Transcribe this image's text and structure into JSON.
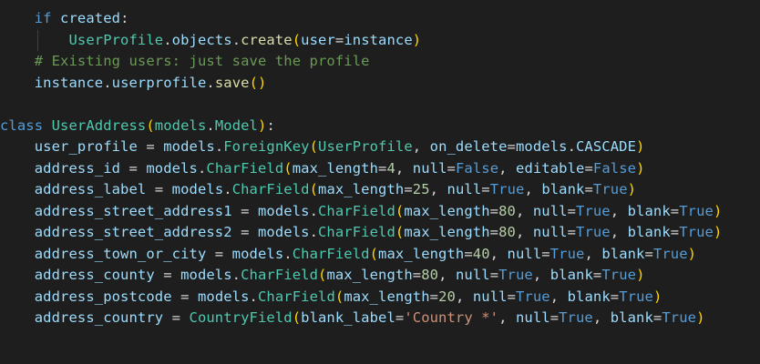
{
  "code_lines": [
    [
      {
        "t": "    ",
        "c": "pl"
      },
      {
        "t": "if",
        "c": "kw"
      },
      {
        "t": " ",
        "c": "pl"
      },
      {
        "t": "created",
        "c": "var"
      },
      {
        "t": ":",
        "c": "pl"
      }
    ],
    [
      {
        "t": "        ",
        "c": "pl"
      },
      {
        "t": "UserProfile",
        "c": "cls"
      },
      {
        "t": ".",
        "c": "pl"
      },
      {
        "t": "objects",
        "c": "var"
      },
      {
        "t": ".",
        "c": "pl"
      },
      {
        "t": "create",
        "c": "fn"
      },
      {
        "t": "(",
        "c": "p1"
      },
      {
        "t": "user",
        "c": "var"
      },
      {
        "t": "=",
        "c": "pl"
      },
      {
        "t": "instance",
        "c": "var"
      },
      {
        "t": ")",
        "c": "p1"
      }
    ],
    [
      {
        "t": "    ",
        "c": "pl"
      },
      {
        "t": "# Existing users: just save the profile",
        "c": "cm"
      }
    ],
    [
      {
        "t": "    ",
        "c": "pl"
      },
      {
        "t": "instance",
        "c": "var"
      },
      {
        "t": ".",
        "c": "pl"
      },
      {
        "t": "userprofile",
        "c": "var"
      },
      {
        "t": ".",
        "c": "pl"
      },
      {
        "t": "save",
        "c": "fn"
      },
      {
        "t": "()",
        "c": "p1"
      }
    ],
    [],
    [
      {
        "t": "class",
        "c": "kw"
      },
      {
        "t": " ",
        "c": "pl"
      },
      {
        "t": "UserAddress",
        "c": "cls"
      },
      {
        "t": "(",
        "c": "p1"
      },
      {
        "t": "models",
        "c": "cls"
      },
      {
        "t": ".",
        "c": "pl"
      },
      {
        "t": "Model",
        "c": "cls"
      },
      {
        "t": ")",
        "c": "p1"
      },
      {
        "t": ":",
        "c": "pl"
      }
    ],
    [
      {
        "t": "    ",
        "c": "pl"
      },
      {
        "t": "user_profile",
        "c": "var"
      },
      {
        "t": " = ",
        "c": "pl"
      },
      {
        "t": "models",
        "c": "var"
      },
      {
        "t": ".",
        "c": "pl"
      },
      {
        "t": "ForeignKey",
        "c": "cls"
      },
      {
        "t": "(",
        "c": "p1"
      },
      {
        "t": "UserProfile",
        "c": "cls"
      },
      {
        "t": ", ",
        "c": "pl"
      },
      {
        "t": "on_delete",
        "c": "var"
      },
      {
        "t": "=",
        "c": "pl"
      },
      {
        "t": "models",
        "c": "var"
      },
      {
        "t": ".",
        "c": "pl"
      },
      {
        "t": "CASCADE",
        "c": "var"
      },
      {
        "t": ")",
        "c": "p1"
      }
    ],
    [
      {
        "t": "    ",
        "c": "pl"
      },
      {
        "t": "address_id",
        "c": "var"
      },
      {
        "t": " = ",
        "c": "pl"
      },
      {
        "t": "models",
        "c": "var"
      },
      {
        "t": ".",
        "c": "pl"
      },
      {
        "t": "CharField",
        "c": "cls"
      },
      {
        "t": "(",
        "c": "p1"
      },
      {
        "t": "max_length",
        "c": "var"
      },
      {
        "t": "=",
        "c": "pl"
      },
      {
        "t": "4",
        "c": "num"
      },
      {
        "t": ", ",
        "c": "pl"
      },
      {
        "t": "null",
        "c": "var"
      },
      {
        "t": "=",
        "c": "pl"
      },
      {
        "t": "False",
        "c": "bool"
      },
      {
        "t": ", ",
        "c": "pl"
      },
      {
        "t": "editable",
        "c": "var"
      },
      {
        "t": "=",
        "c": "pl"
      },
      {
        "t": "False",
        "c": "bool"
      },
      {
        "t": ")",
        "c": "p1"
      }
    ],
    [
      {
        "t": "    ",
        "c": "pl"
      },
      {
        "t": "address_label",
        "c": "var"
      },
      {
        "t": " = ",
        "c": "pl"
      },
      {
        "t": "models",
        "c": "var"
      },
      {
        "t": ".",
        "c": "pl"
      },
      {
        "t": "CharField",
        "c": "cls"
      },
      {
        "t": "(",
        "c": "p1"
      },
      {
        "t": "max_length",
        "c": "var"
      },
      {
        "t": "=",
        "c": "pl"
      },
      {
        "t": "25",
        "c": "num"
      },
      {
        "t": ", ",
        "c": "pl"
      },
      {
        "t": "null",
        "c": "var"
      },
      {
        "t": "=",
        "c": "pl"
      },
      {
        "t": "True",
        "c": "bool"
      },
      {
        "t": ", ",
        "c": "pl"
      },
      {
        "t": "blank",
        "c": "var"
      },
      {
        "t": "=",
        "c": "pl"
      },
      {
        "t": "True",
        "c": "bool"
      },
      {
        "t": ")",
        "c": "p1"
      }
    ],
    [
      {
        "t": "    ",
        "c": "pl"
      },
      {
        "t": "address_street_address1",
        "c": "var"
      },
      {
        "t": " = ",
        "c": "pl"
      },
      {
        "t": "models",
        "c": "var"
      },
      {
        "t": ".",
        "c": "pl"
      },
      {
        "t": "CharField",
        "c": "cls"
      },
      {
        "t": "(",
        "c": "p1"
      },
      {
        "t": "max_length",
        "c": "var"
      },
      {
        "t": "=",
        "c": "pl"
      },
      {
        "t": "80",
        "c": "num"
      },
      {
        "t": ", ",
        "c": "pl"
      },
      {
        "t": "null",
        "c": "var"
      },
      {
        "t": "=",
        "c": "pl"
      },
      {
        "t": "True",
        "c": "bool"
      },
      {
        "t": ", ",
        "c": "pl"
      },
      {
        "t": "blank",
        "c": "var"
      },
      {
        "t": "=",
        "c": "pl"
      },
      {
        "t": "True",
        "c": "bool"
      },
      {
        "t": ")",
        "c": "p1"
      }
    ],
    [
      {
        "t": "    ",
        "c": "pl"
      },
      {
        "t": "address_street_address2",
        "c": "var"
      },
      {
        "t": " = ",
        "c": "pl"
      },
      {
        "t": "models",
        "c": "var"
      },
      {
        "t": ".",
        "c": "pl"
      },
      {
        "t": "CharField",
        "c": "cls"
      },
      {
        "t": "(",
        "c": "p1"
      },
      {
        "t": "max_length",
        "c": "var"
      },
      {
        "t": "=",
        "c": "pl"
      },
      {
        "t": "80",
        "c": "num"
      },
      {
        "t": ", ",
        "c": "pl"
      },
      {
        "t": "null",
        "c": "var"
      },
      {
        "t": "=",
        "c": "pl"
      },
      {
        "t": "True",
        "c": "bool"
      },
      {
        "t": ", ",
        "c": "pl"
      },
      {
        "t": "blank",
        "c": "var"
      },
      {
        "t": "=",
        "c": "pl"
      },
      {
        "t": "True",
        "c": "bool"
      },
      {
        "t": ")",
        "c": "p1"
      }
    ],
    [
      {
        "t": "    ",
        "c": "pl"
      },
      {
        "t": "address_town_or_city",
        "c": "var"
      },
      {
        "t": " = ",
        "c": "pl"
      },
      {
        "t": "models",
        "c": "var"
      },
      {
        "t": ".",
        "c": "pl"
      },
      {
        "t": "CharField",
        "c": "cls"
      },
      {
        "t": "(",
        "c": "p1"
      },
      {
        "t": "max_length",
        "c": "var"
      },
      {
        "t": "=",
        "c": "pl"
      },
      {
        "t": "40",
        "c": "num"
      },
      {
        "t": ", ",
        "c": "pl"
      },
      {
        "t": "null",
        "c": "var"
      },
      {
        "t": "=",
        "c": "pl"
      },
      {
        "t": "True",
        "c": "bool"
      },
      {
        "t": ", ",
        "c": "pl"
      },
      {
        "t": "blank",
        "c": "var"
      },
      {
        "t": "=",
        "c": "pl"
      },
      {
        "t": "True",
        "c": "bool"
      },
      {
        "t": ")",
        "c": "p1"
      }
    ],
    [
      {
        "t": "    ",
        "c": "pl"
      },
      {
        "t": "address_county",
        "c": "var"
      },
      {
        "t": " = ",
        "c": "pl"
      },
      {
        "t": "models",
        "c": "var"
      },
      {
        "t": ".",
        "c": "pl"
      },
      {
        "t": "CharField",
        "c": "cls"
      },
      {
        "t": "(",
        "c": "p1"
      },
      {
        "t": "max_length",
        "c": "var"
      },
      {
        "t": "=",
        "c": "pl"
      },
      {
        "t": "80",
        "c": "num"
      },
      {
        "t": ", ",
        "c": "pl"
      },
      {
        "t": "null",
        "c": "var"
      },
      {
        "t": "=",
        "c": "pl"
      },
      {
        "t": "True",
        "c": "bool"
      },
      {
        "t": ", ",
        "c": "pl"
      },
      {
        "t": "blank",
        "c": "var"
      },
      {
        "t": "=",
        "c": "pl"
      },
      {
        "t": "True",
        "c": "bool"
      },
      {
        "t": ")",
        "c": "p1"
      }
    ],
    [
      {
        "t": "    ",
        "c": "pl"
      },
      {
        "t": "address_postcode",
        "c": "var"
      },
      {
        "t": " = ",
        "c": "pl"
      },
      {
        "t": "models",
        "c": "var"
      },
      {
        "t": ".",
        "c": "pl"
      },
      {
        "t": "CharField",
        "c": "cls"
      },
      {
        "t": "(",
        "c": "p1"
      },
      {
        "t": "max_length",
        "c": "var"
      },
      {
        "t": "=",
        "c": "pl"
      },
      {
        "t": "20",
        "c": "num"
      },
      {
        "t": ", ",
        "c": "pl"
      },
      {
        "t": "null",
        "c": "var"
      },
      {
        "t": "=",
        "c": "pl"
      },
      {
        "t": "True",
        "c": "bool"
      },
      {
        "t": ", ",
        "c": "pl"
      },
      {
        "t": "blank",
        "c": "var"
      },
      {
        "t": "=",
        "c": "pl"
      },
      {
        "t": "True",
        "c": "bool"
      },
      {
        "t": ")",
        "c": "p1"
      }
    ],
    [
      {
        "t": "    ",
        "c": "pl"
      },
      {
        "t": "address_country",
        "c": "var"
      },
      {
        "t": " = ",
        "c": "pl"
      },
      {
        "t": "CountryField",
        "c": "cls"
      },
      {
        "t": "(",
        "c": "p1"
      },
      {
        "t": "blank_label",
        "c": "var"
      },
      {
        "t": "=",
        "c": "pl"
      },
      {
        "t": "'Country *'",
        "c": "str"
      },
      {
        "t": ", ",
        "c": "pl"
      },
      {
        "t": "null",
        "c": "var"
      },
      {
        "t": "=",
        "c": "pl"
      },
      {
        "t": "True",
        "c": "bool"
      },
      {
        "t": ", ",
        "c": "pl"
      },
      {
        "t": "blank",
        "c": "var"
      },
      {
        "t": "=",
        "c": "pl"
      },
      {
        "t": "True",
        "c": "bool"
      },
      {
        "t": ")",
        "c": "p1"
      }
    ]
  ],
  "colors": {
    "background": "#1e1e1e",
    "keyword": "#569cd6",
    "class_name": "#4ec9b0",
    "identifier": "#9cdcfe",
    "function": "#dcdcaa",
    "number": "#b5cea8",
    "string": "#ce9178",
    "comment": "#6a9955",
    "bracket": "#ffd700"
  }
}
